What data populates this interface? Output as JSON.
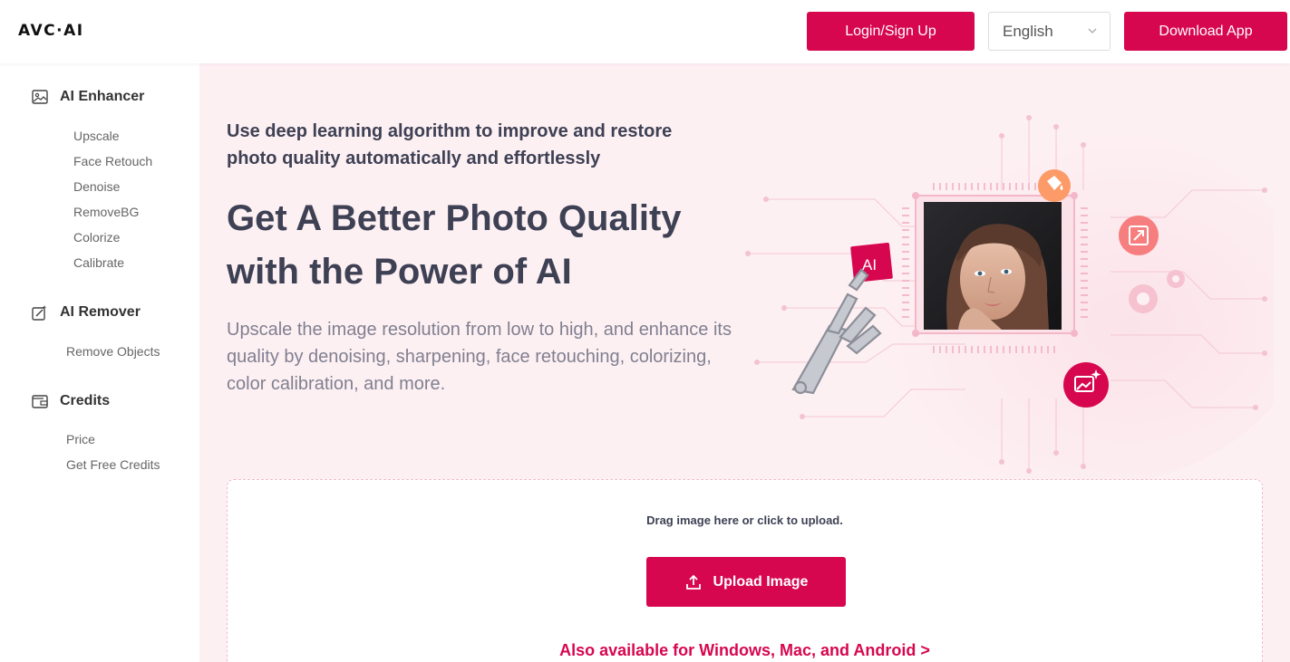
{
  "header": {
    "logo": "AVC·AI",
    "login_label": "Login/Sign Up",
    "language": "English",
    "download_label": "Download App"
  },
  "sidebar": {
    "sections": [
      {
        "title": "AI Enhancer",
        "icon": "image-icon",
        "items": [
          "Upscale",
          "Face Retouch",
          "Denoise",
          "RemoveBG",
          "Colorize",
          "Calibrate"
        ]
      },
      {
        "title": "AI Remover",
        "icon": "magic-edit-icon",
        "items": [
          "Remove Objects"
        ]
      },
      {
        "title": "Credits",
        "icon": "wallet-icon",
        "items": [
          "Price",
          "Get Free Credits"
        ]
      }
    ]
  },
  "hero": {
    "tagline": "Use deep learning algorithm to improve and restore photo quality automatically and effortlessly",
    "headline": "Get A Better Photo Quality with the Power of AI",
    "description": "Upscale the image resolution from low to high, and enhance its quality by denoising, sharpening, face retouching, colorizing, color calibration, and more.",
    "ai_badge": "AI"
  },
  "upload": {
    "drag_text": "Drag image here or click to upload.",
    "button_label": "Upload Image",
    "also_available": "Also available for Windows, Mac, and Android >"
  },
  "colors": {
    "accent": "#d7074f",
    "background": "#fdf0f3",
    "orange": "#fc9a68",
    "salmon": "#f77e7e"
  }
}
